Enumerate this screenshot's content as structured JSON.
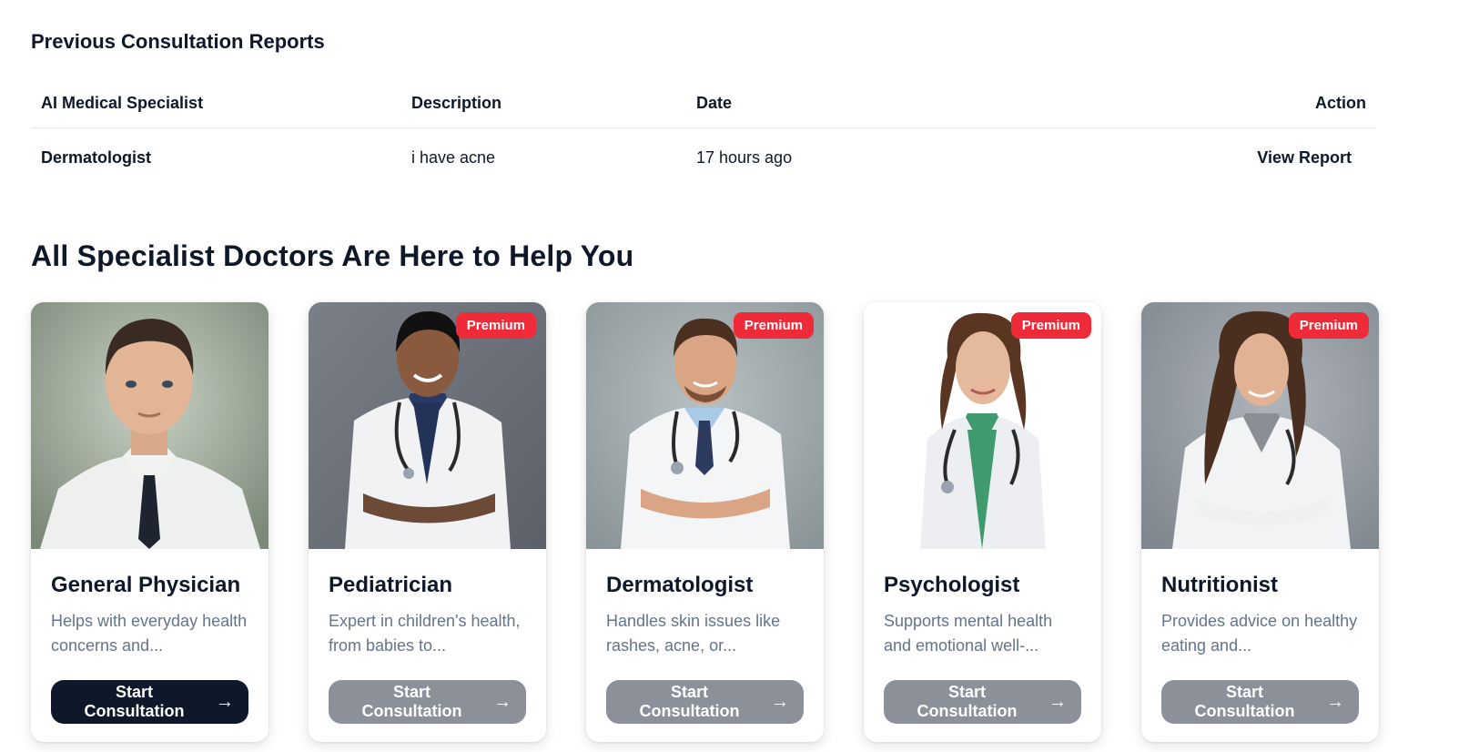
{
  "reports": {
    "title": "Previous Consultation Reports",
    "columns": [
      "AI Medical Specialist",
      "Description",
      "Date",
      "Action"
    ],
    "rows": [
      {
        "specialist": "Dermatologist",
        "description": "i have acne",
        "date": "17 hours ago",
        "action": "View Report"
      }
    ]
  },
  "doctors": {
    "heading": "All Specialist Doctors Are Here to Help You",
    "badge_label": "Premium",
    "button_label": "Start Consultation",
    "arrow_icon": "arrow-right-icon",
    "colors": {
      "badge": "#ef2b3a",
      "active_button": "#0f172a",
      "disabled_button": "#8b9099"
    },
    "items": [
      {
        "name": "General Physician",
        "description": "Helps with everyday health concerns and...",
        "premium": false,
        "button_active": true
      },
      {
        "name": "Pediatrician",
        "description": "Expert in children's health, from babies to...",
        "premium": true,
        "button_active": false
      },
      {
        "name": "Dermatologist",
        "description": "Handles skin issues like rashes, acne, or...",
        "premium": true,
        "button_active": false
      },
      {
        "name": "Psychologist",
        "description": "Supports mental health and emotional well-...",
        "premium": true,
        "button_active": false
      },
      {
        "name": "Nutritionist",
        "description": "Provides advice on healthy eating and...",
        "premium": true,
        "button_active": false
      }
    ]
  }
}
